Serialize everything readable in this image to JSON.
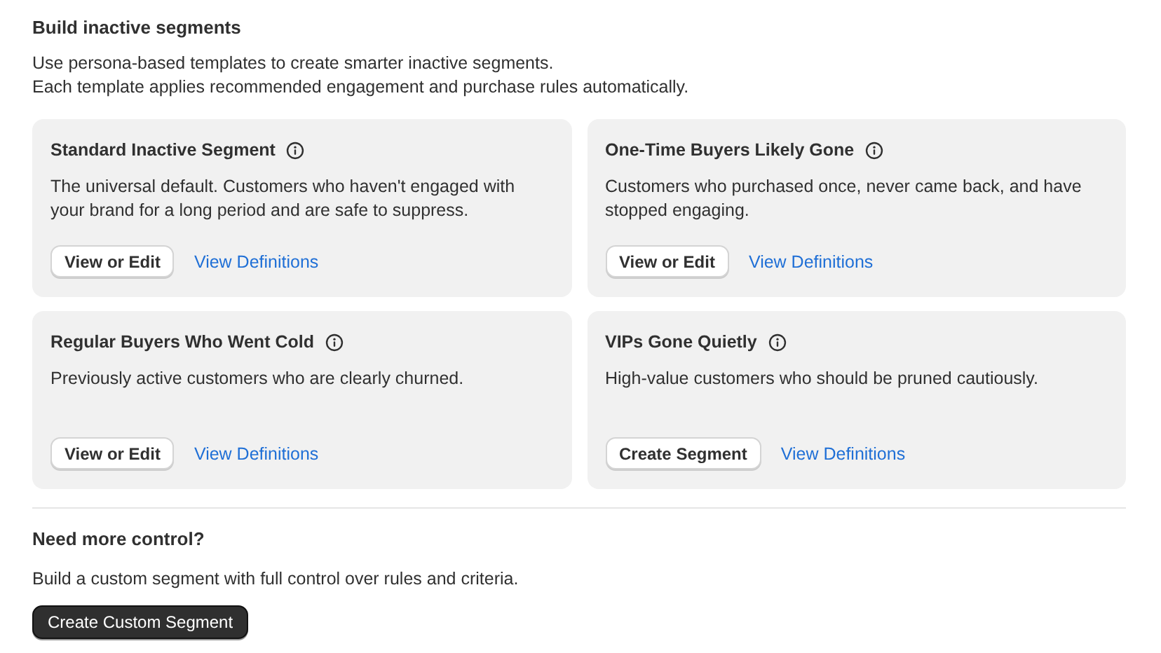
{
  "header": {
    "title": "Build inactive segments",
    "description_lines": [
      "Use persona-based templates to create smarter inactive segments.",
      "Each template applies recommended engagement and purchase rules automatically."
    ]
  },
  "templates": [
    {
      "title": "Standard Inactive Segment",
      "description": "The universal default. Customers who haven't engaged with your brand for a long period and are safe to suppress.",
      "primary_button": "View or Edit",
      "link": "View Definitions"
    },
    {
      "title": "One-Time Buyers Likely Gone",
      "description": "Customers who purchased once, never came back, and have stopped engaging.",
      "primary_button": "View or Edit",
      "link": "View Definitions"
    },
    {
      "title": "Regular Buyers Who Went Cold",
      "description": "Previously active customers who are clearly churned.",
      "primary_button": "View or Edit",
      "link": "View Definitions"
    },
    {
      "title": "VIPs Gone Quietly",
      "description": "High-value customers who should be pruned cautiously.",
      "primary_button": "Create Segment",
      "link": "View Definitions"
    }
  ],
  "custom": {
    "title": "Need more control?",
    "description": "Build a custom segment with full control over rules and criteria.",
    "button": "Create Custom Segment"
  }
}
